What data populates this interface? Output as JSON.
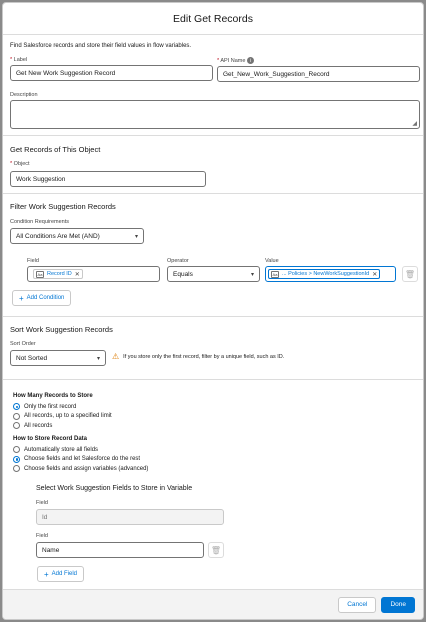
{
  "header": {
    "title": "Edit Get Records"
  },
  "intro": "Find Salesforce records and store their field values in flow variables.",
  "label_field": {
    "label": "Label",
    "value": "Get New Work Suggestion Record"
  },
  "api_name_field": {
    "label": "API Name",
    "value": "Get_New_Work_Suggestion_Record"
  },
  "description_field": {
    "label": "Description",
    "value": ""
  },
  "object_section": {
    "title": "Get Records of This Object",
    "object_label": "Object",
    "object_value": "Work Suggestion"
  },
  "filter_section": {
    "title": "Filter Work Suggestion Records",
    "condition_req_label": "Condition Requirements",
    "condition_req_value": "All Conditions Are Met (AND)",
    "field_label": "Field",
    "operator_label": "Operator",
    "value_label": "Value",
    "field_value": "Record ID",
    "operator_value": "Equals",
    "value_value": "... Policies > NewWorkSuggestionId",
    "add_condition": "Add Condition"
  },
  "sort_section": {
    "title": "Sort Work Suggestion Records",
    "sort_order_label": "Sort Order",
    "sort_order_value": "Not Sorted",
    "warning": "If you store only the first record, filter by a unique field, such as ID."
  },
  "store_section": {
    "how_many_title": "How Many Records to Store",
    "how_many_options": [
      "Only the first record",
      "All records, up to a specified limit",
      "All records"
    ],
    "how_to_title": "How to Store Record Data",
    "how_to_options": [
      "Automatically store all fields",
      "Choose fields and let Salesforce do the rest",
      "Choose fields and assign variables (advanced)"
    ],
    "select_fields_title": "Select Work Suggestion Fields to Store in Variable",
    "field1_label": "Field",
    "field1_value": "Id",
    "field2_label": "Field",
    "field2_value": "Name",
    "add_field": "Add Field"
  },
  "footer": {
    "cancel": "Cancel",
    "done": "Done"
  },
  "colors": {
    "brand": "#0176d3",
    "warning": "#dd7a01",
    "required": "#ba0517"
  }
}
